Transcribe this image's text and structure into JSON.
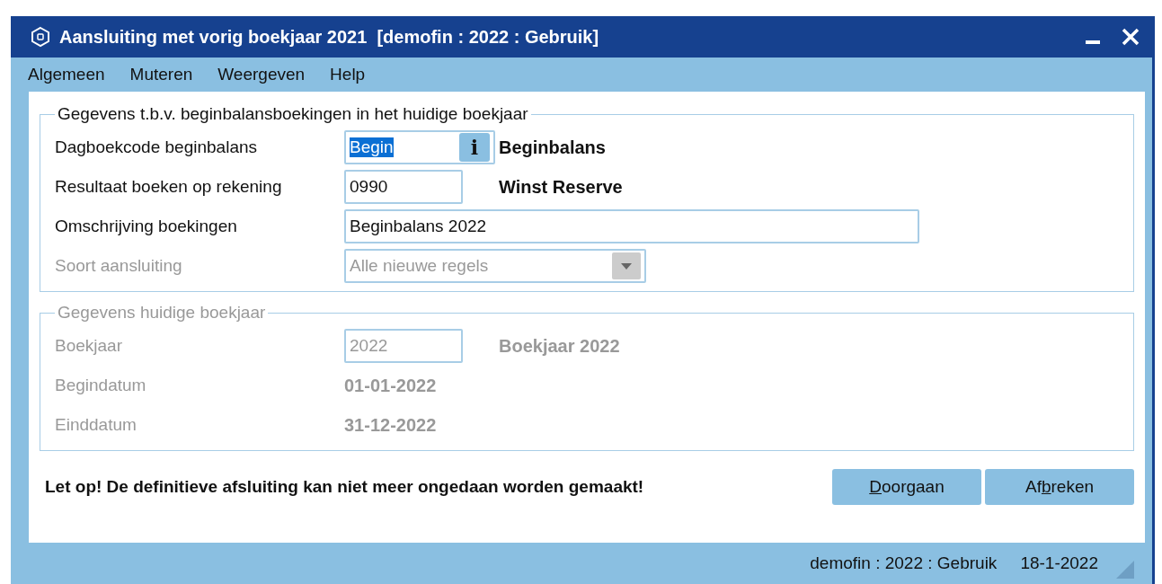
{
  "window": {
    "title": "Aansluiting met vorig boekjaar 2021  [demofin : 2022 : Gebruik]"
  },
  "menu": [
    "Algemeen",
    "Muteren",
    "Weergeven",
    "Help"
  ],
  "sections": [
    {
      "title": "Gegevens t.b.v. beginbalansboekingen in het huidige boekjaar",
      "disabled": false,
      "rows": [
        {
          "kind": "lookup",
          "label": "Dagboekcode beginbalans",
          "value": "Begin",
          "selected": true,
          "info_button": "i",
          "description": "Beginbalans",
          "disabled": false
        },
        {
          "kind": "lookup",
          "label": "Resultaat boeken op rekening",
          "value": "0990",
          "selected": false,
          "description": "Winst Reserve",
          "disabled": false
        },
        {
          "kind": "wide",
          "label": "Omschrijving boekingen",
          "value": "Beginbalans 2022",
          "selected": false,
          "disabled": false
        },
        {
          "kind": "dropdown",
          "label": "Soort aansluiting",
          "value": "Alle nieuwe regels",
          "disabled": true
        }
      ]
    },
    {
      "title": "Gegevens huidige boekjaar",
      "disabled": true,
      "rows": [
        {
          "kind": "lookup",
          "label": "Boekjaar",
          "value": "2022",
          "selected": false,
          "description": "Boekjaar 2022",
          "disabled": true
        },
        {
          "kind": "static",
          "label": "Begindatum",
          "description": "01-01-2022",
          "disabled": true
        },
        {
          "kind": "static",
          "label": "Einddatum",
          "description": "31-12-2022",
          "disabled": true
        }
      ]
    }
  ],
  "warning": "Let op! De definitieve afsluiting kan niet meer ongedaan worden gemaakt!",
  "buttons": [
    {
      "accelerator": "D",
      "after": "oorgaan"
    },
    {
      "before": "Af",
      "accelerator": "b",
      "after": "reken"
    }
  ],
  "status_bar": [
    "demofin : 2022 : Gebruik",
    "18-1-2022"
  ]
}
